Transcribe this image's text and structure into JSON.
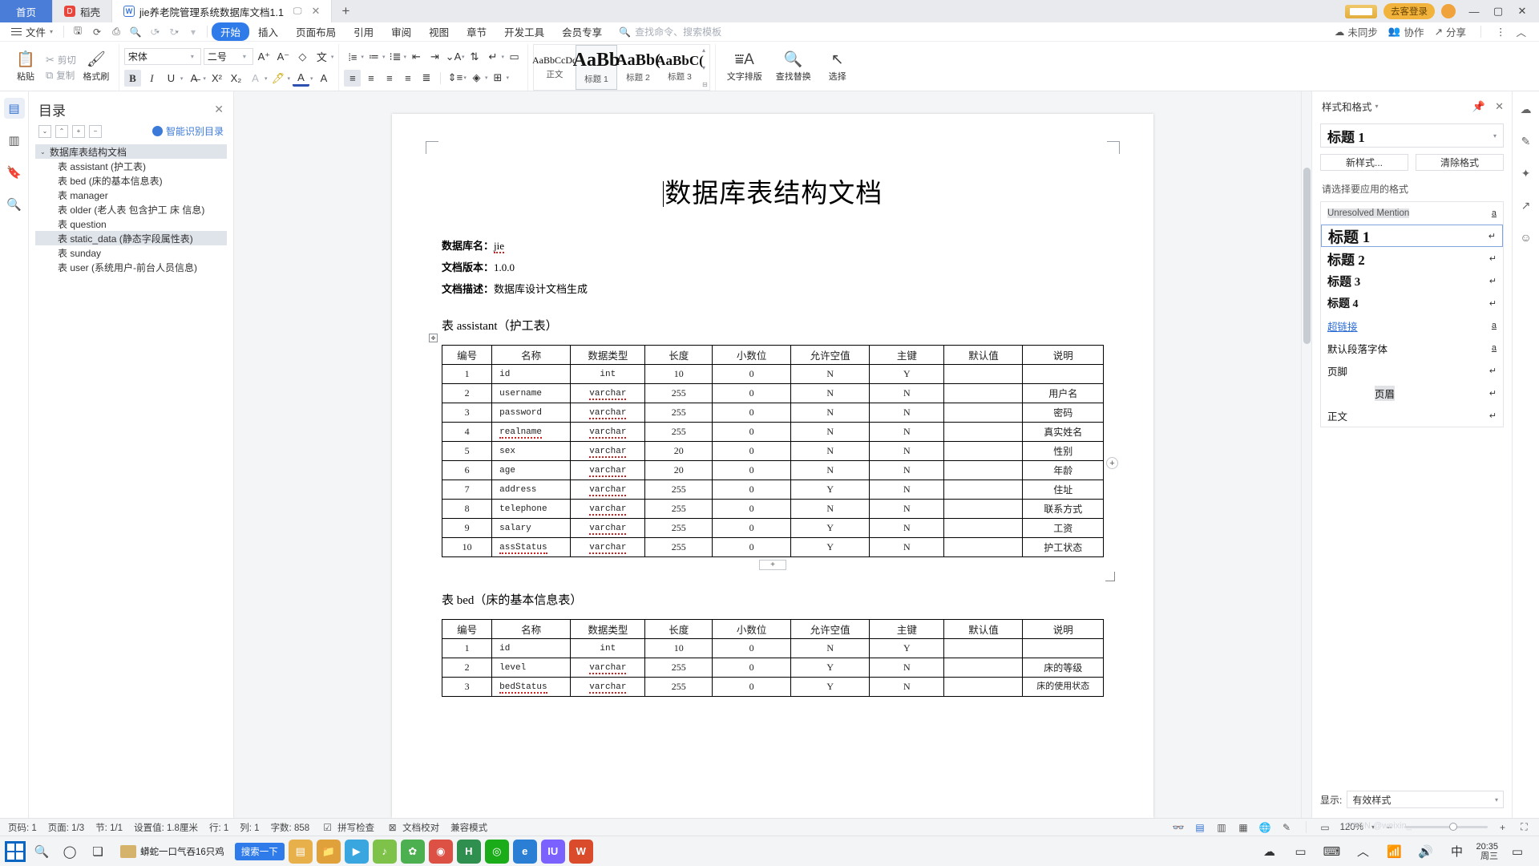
{
  "window": {
    "tabs": [
      {
        "label": "首页",
        "kind": "home"
      },
      {
        "label": "稻壳",
        "kind": "docer",
        "icon": "docer-icon"
      },
      {
        "label": "jie养老院管理系统数据库文档1.1",
        "kind": "document",
        "icon": "wps-writer-icon"
      }
    ],
    "new_tab": "+",
    "login_label": "去客登录",
    "controls": {
      "minimize": "—",
      "maximize": "▢",
      "close": "✕"
    }
  },
  "menubar": {
    "file_label": "文件",
    "quick_icons": [
      "save-icon",
      "undo-cloud-icon",
      "print-icon",
      "print-preview-icon",
      "undo-icon",
      "redo-icon",
      "customize-icon"
    ],
    "tabs": [
      {
        "label": "开始",
        "active": true
      },
      {
        "label": "插入",
        "active": false
      },
      {
        "label": "页面布局",
        "active": false
      },
      {
        "label": "引用",
        "active": false
      },
      {
        "label": "审阅",
        "active": false
      },
      {
        "label": "视图",
        "active": false
      },
      {
        "label": "章节",
        "active": false
      },
      {
        "label": "开发工具",
        "active": false
      },
      {
        "label": "会员专享",
        "active": false
      }
    ],
    "command_search": "查找命令、搜索模板",
    "right": [
      {
        "label": "未同步",
        "icon": "cloud-sync-icon"
      },
      {
        "label": "协作",
        "icon": "collaborate-icon"
      },
      {
        "label": "分享",
        "icon": "share-icon"
      }
    ],
    "more": "⋮",
    "collapse": "︿"
  },
  "ribbon": {
    "clipboard": {
      "paste": "粘贴",
      "cut": "剪切",
      "copy": "复制",
      "format_painter": "格式刷"
    },
    "font": {
      "family": "宋体",
      "size": "二号",
      "grow": "A⁺",
      "shrink": "A⁻",
      "clear_format": "clear-format-icon",
      "pinyin": "拼音指南",
      "bold": "B",
      "italic": "I",
      "underline": "U",
      "strikethrough": "A",
      "superscript": "X²",
      "subscript": "X₂",
      "text_effect": "A",
      "highlight": "highlight-icon",
      "font_color": "A",
      "char_border": "A"
    },
    "paragraph": {
      "bullets": "bullet-list-icon",
      "numbering": "numbered-list-icon",
      "multilevel": "multilevel-list-icon",
      "decrease_indent": "decrease-indent-icon",
      "increase_indent": "increase-indent-icon",
      "pinyin_guide": "character-scale-icon",
      "sort": "sort-icon",
      "show_marks": "show-marks-icon",
      "ruler": "ruler-icon",
      "align_left": "align-left-icon",
      "align_center": "align-center-icon",
      "align_right": "align-right-icon",
      "justify": "justify-icon",
      "distribute": "distribute-icon",
      "line_spacing": "line-spacing-icon",
      "shading": "shading-icon",
      "borders": "borders-icon"
    },
    "styles": {
      "gallery": [
        {
          "preview": "AaBbCcDd",
          "name": "正文",
          "selected": false,
          "size": 12
        },
        {
          "preview": "AaBb",
          "name": "标题 1",
          "selected": true,
          "size": 24
        },
        {
          "preview": "AaBb(",
          "name": "标题 2",
          "selected": false,
          "size": 20
        },
        {
          "preview": "AaBbC(",
          "name": "标题 3",
          "selected": false,
          "size": 17
        }
      ]
    },
    "tools": {
      "text_layout": "文字排版",
      "find_replace": "查找替换",
      "select": "选择"
    }
  },
  "left_rail": [
    {
      "icon": "outline-icon",
      "active": true
    },
    {
      "icon": "thumbnail-icon",
      "active": false
    },
    {
      "icon": "bookmark-icon",
      "active": false
    },
    {
      "icon": "search-icon",
      "active": false
    }
  ],
  "nav_panel": {
    "title": "目录",
    "close": "✕",
    "tools": [
      "expand-all-icon",
      "collapse-all-icon",
      "promote-icon",
      "demote-icon"
    ],
    "smart_toc": "智能识别目录",
    "items": [
      {
        "label": "数据库表结构文档",
        "level": 0,
        "selected": true,
        "expanded": true
      },
      {
        "label": "表 assistant (护工表)",
        "level": 1,
        "selected": false
      },
      {
        "label": "表 bed (床的基本信息表)",
        "level": 1,
        "selected": false
      },
      {
        "label": "表 manager",
        "level": 1,
        "selected": false
      },
      {
        "label": "表 older (老人表  包含护工  床  信息)",
        "level": 1,
        "selected": false
      },
      {
        "label": "表 question",
        "level": 1,
        "selected": false
      },
      {
        "label": "表 static_data (静态字段属性表)",
        "level": 1,
        "selected": true
      },
      {
        "label": "表 sunday",
        "level": 1,
        "selected": false
      },
      {
        "label": "表 user (系统用户-前台人员信息)",
        "level": 1,
        "selected": false
      }
    ]
  },
  "document": {
    "title": "数据库表结构文档",
    "meta": [
      {
        "label": "数据库名：",
        "value": "jie",
        "misspelled": true
      },
      {
        "label": "文档版本：",
        "value": "1.0.0",
        "misspelled": false
      },
      {
        "label": "文档描述：",
        "value": "数据库设计文档生成",
        "misspelled": false
      }
    ],
    "table_headers": [
      "编号",
      "名称",
      "数据类型",
      "长度",
      "小数位",
      "允许空值",
      "主键",
      "默认值",
      "说明"
    ],
    "sections": [
      {
        "heading": "表 assistant（护工表）",
        "rows": [
          [
            "1",
            "id",
            "int",
            "10",
            "0",
            "N",
            "Y",
            "",
            ""
          ],
          [
            "2",
            "username",
            "varchar",
            "255",
            "0",
            "N",
            "N",
            "",
            "用户名"
          ],
          [
            "3",
            "password",
            "varchar",
            "255",
            "0",
            "N",
            "N",
            "",
            "密码"
          ],
          [
            "4",
            "realname",
            "varchar",
            "255",
            "0",
            "N",
            "N",
            "",
            "真实姓名"
          ],
          [
            "5",
            "sex",
            "varchar",
            "20",
            "0",
            "N",
            "N",
            "",
            "性别"
          ],
          [
            "6",
            "age",
            "varchar",
            "20",
            "0",
            "N",
            "N",
            "",
            "年龄"
          ],
          [
            "7",
            "address",
            "varchar",
            "255",
            "0",
            "Y",
            "N",
            "",
            "住址"
          ],
          [
            "8",
            "telephone",
            "varchar",
            "255",
            "0",
            "N",
            "N",
            "",
            "联系方式"
          ],
          [
            "9",
            "salary",
            "varchar",
            "255",
            "0",
            "Y",
            "N",
            "",
            "工资"
          ],
          [
            "10",
            "assStatus",
            "varchar",
            "255",
            "0",
            "Y",
            "N",
            "",
            "护工状态"
          ]
        ]
      },
      {
        "heading": "表 bed（床的基本信息表）",
        "rows": [
          [
            "1",
            "id",
            "int",
            "10",
            "0",
            "N",
            "Y",
            "",
            ""
          ],
          [
            "2",
            "level",
            "varchar",
            "255",
            "0",
            "Y",
            "N",
            "",
            "床的等级"
          ],
          [
            "3",
            "bedStatus",
            "varchar",
            "255",
            "0",
            "Y",
            "N",
            "",
            "床的使用状态"
          ]
        ]
      }
    ]
  },
  "style_panel": {
    "title": "样式和格式",
    "pin": "pin-icon",
    "close": "✕",
    "current_style": "标题 1",
    "new_style": "新样式...",
    "clear_format": "清除格式",
    "instruction": "请选择要应用的格式",
    "items": [
      {
        "label": "Unresolved Mention",
        "mark": "a",
        "kind": "character",
        "selected": false,
        "highlight": true,
        "size": 12,
        "bold": false
      },
      {
        "label": "标题 1",
        "mark": "↵",
        "kind": "paragraph",
        "selected": true,
        "highlight": false,
        "size": 19,
        "bold": true
      },
      {
        "label": "标题 2",
        "mark": "↵",
        "kind": "paragraph",
        "selected": false,
        "highlight": false,
        "size": 17,
        "bold": true
      },
      {
        "label": "标题 3",
        "mark": "↵",
        "kind": "paragraph",
        "selected": false,
        "highlight": false,
        "size": 15,
        "bold": true
      },
      {
        "label": "标题 4",
        "mark": "↵",
        "kind": "paragraph",
        "selected": false,
        "highlight": false,
        "size": 14,
        "bold": true
      },
      {
        "label": "超链接",
        "mark": "a",
        "kind": "character",
        "selected": false,
        "highlight": false,
        "size": 12,
        "bold": false,
        "link": true
      },
      {
        "label": "默认段落字体",
        "mark": "a",
        "kind": "character",
        "selected": false,
        "highlight": false,
        "size": 12,
        "bold": false
      },
      {
        "label": "页脚",
        "mark": "↵",
        "kind": "paragraph",
        "selected": false,
        "highlight": false,
        "size": 12,
        "bold": false
      },
      {
        "label": "页眉",
        "mark": "↵",
        "kind": "paragraph",
        "selected": false,
        "highlight": true,
        "size": 12,
        "bold": false,
        "center": true
      },
      {
        "label": "正文",
        "mark": "↵",
        "kind": "paragraph",
        "selected": false,
        "highlight": false,
        "size": 12,
        "bold": false
      }
    ],
    "show_label": "显示:",
    "show_value": "有效样式"
  },
  "far_rail": [
    {
      "icon": "docer-cloud-icon"
    },
    {
      "icon": "edit-pen-icon"
    },
    {
      "icon": "ai-star-icon"
    },
    {
      "icon": "cursor-arrow-icon"
    },
    {
      "icon": "help-circle-icon"
    }
  ],
  "statusbar": {
    "page_number": "页码: 1",
    "pages": "页面: 1/3",
    "section": "节: 1/1",
    "setting": "设置值: 1.8厘米",
    "row": "行: 1",
    "column": "列: 1",
    "word_count": "字数: 858",
    "spellcheck": "拼写检查",
    "proofread": "文档校对",
    "compat_mode": "兼容模式",
    "view_icons": [
      "web-layout-icon",
      "page-layout-icon",
      "outline-view-icon",
      "reading-view-icon",
      "print-preview-icon",
      "web-view-icon",
      "edit-icon"
    ],
    "zoom_out": "−",
    "zoom_in": "+",
    "zoom_level": "120%",
    "fullscreen": "⛶"
  },
  "taskbar": {
    "start": "start-icon",
    "search": "search-icon",
    "cortana": "cortana-icon",
    "taskview": "task-view-icon",
    "news_text": "蟒蛇一口气吞16只鸡",
    "search_button": "搜索一下",
    "apps": [
      {
        "name": "folder-icon",
        "color": "#e8b04b",
        "glyph": "▤"
      },
      {
        "name": "edge-icon",
        "color": "#2f7bea",
        "glyph": "e"
      },
      {
        "name": "movie-icon",
        "color": "#3aa6e0",
        "glyph": "▶"
      },
      {
        "name": "music-icon",
        "color": "#8bc34a",
        "glyph": "♪"
      },
      {
        "name": "leaf-icon",
        "color": "#4caf50",
        "glyph": "✿"
      },
      {
        "name": "chrome-icon",
        "color": "#dd5145",
        "glyph": "◉"
      },
      {
        "name": "navicat-icon",
        "color": "#2f8f4e",
        "glyph": "H"
      },
      {
        "name": "wechat-icon",
        "color": "#1aad19",
        "glyph": "◎"
      },
      {
        "name": "ie-icon",
        "color": "#2a7fd4",
        "glyph": "e"
      },
      {
        "name": "idea-icon",
        "color": "#7b61ff",
        "glyph": "IU"
      },
      {
        "name": "wps-icon",
        "color": "#d94b2b",
        "glyph": "W"
      }
    ],
    "tray": [
      "cloud-icon",
      "battery-icon",
      "keyboard-icon",
      "chevron-up-icon",
      "wifi-icon",
      "volume-icon",
      "input-method-icon"
    ],
    "time": "20:35",
    "date": "周三",
    "notification": "notification-icon"
  },
  "watermark": "CSDN @weixin_..."
}
